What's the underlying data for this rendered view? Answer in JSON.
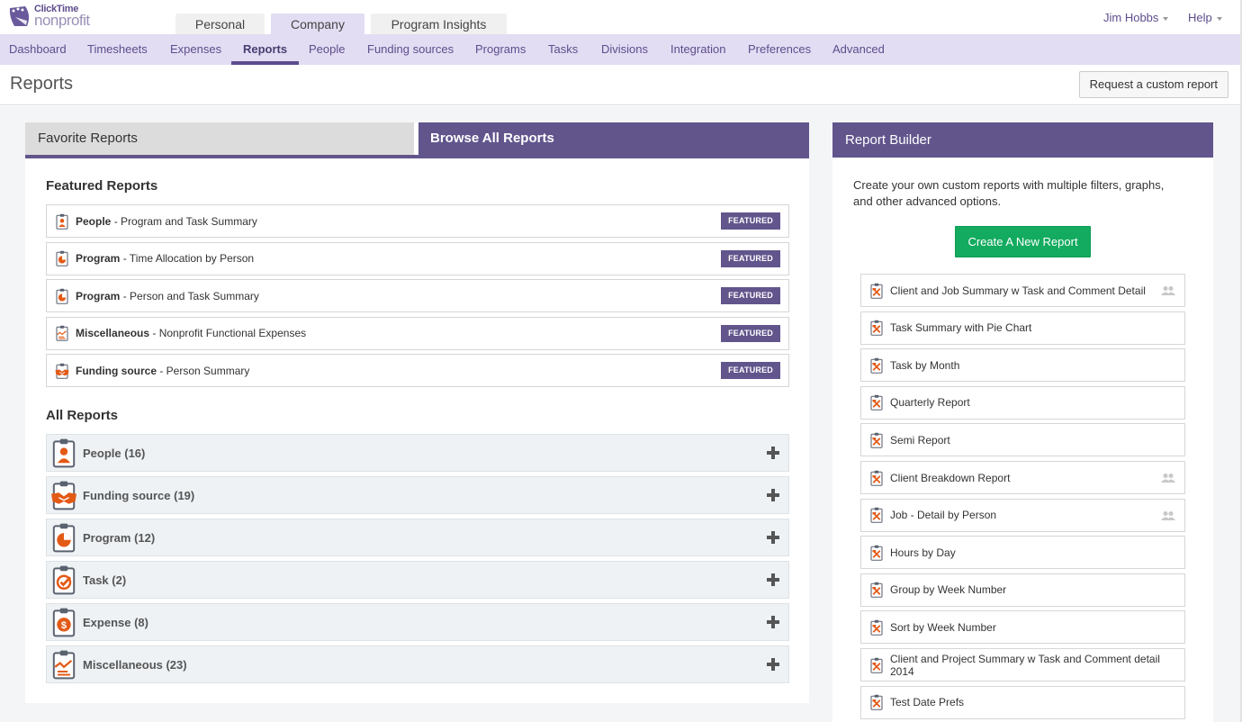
{
  "app": {
    "logo_line1": "ClickTime",
    "logo_line2": "nonprofit",
    "brand_color": "#62558c",
    "accent_color": "#e35a16"
  },
  "top_tabs": [
    {
      "label": "Personal",
      "active": false
    },
    {
      "label": "Company",
      "active": true
    },
    {
      "label": "Program Insights",
      "active": false
    }
  ],
  "user_menu": {
    "name": "Jim Hobbs",
    "help": "Help"
  },
  "nav": [
    {
      "label": "Dashboard"
    },
    {
      "label": "Timesheets"
    },
    {
      "label": "Expenses"
    },
    {
      "label": "Reports",
      "active": true
    },
    {
      "label": "People"
    },
    {
      "label": "Funding sources"
    },
    {
      "label": "Programs"
    },
    {
      "label": "Tasks"
    },
    {
      "label": "Divisions"
    },
    {
      "label": "Integration"
    },
    {
      "label": "Preferences"
    },
    {
      "label": "Advanced"
    }
  ],
  "page": {
    "title": "Reports",
    "request_button": "Request a custom report"
  },
  "report_tabs": {
    "favorites": "Favorite Reports",
    "browse": "Browse All Reports",
    "active": "browse"
  },
  "featured": {
    "title": "Featured Reports",
    "badge_label": "FEATURED",
    "items": [
      {
        "category": "People",
        "name": " - Program and Task Summary",
        "icon": "people-report-icon"
      },
      {
        "category": "Program",
        "name": " - Time Allocation by Person",
        "icon": "program-report-icon"
      },
      {
        "category": "Program",
        "name": " - Person and Task Summary",
        "icon": "program-report-icon"
      },
      {
        "category": "Miscellaneous",
        "name": " - Nonprofit Functional Expenses",
        "icon": "misc-report-icon"
      },
      {
        "category": "Funding source",
        "name": " - Person Summary",
        "icon": "funding-report-icon"
      }
    ]
  },
  "all_reports": {
    "title": "All Reports",
    "categories": [
      {
        "label": "People (16)",
        "icon": "people-report-icon"
      },
      {
        "label": "Funding source (19)",
        "icon": "funding-report-icon"
      },
      {
        "label": "Program (12)",
        "icon": "program-report-icon"
      },
      {
        "label": "Task (2)",
        "icon": "task-report-icon"
      },
      {
        "label": "Expense (8)",
        "icon": "expense-report-icon"
      },
      {
        "label": "Miscellaneous (23)",
        "icon": "misc-report-icon"
      }
    ]
  },
  "report_builder": {
    "title": "Report Builder",
    "description": "Create your own custom reports with multiple filters, graphs, and other advanced options.",
    "create_button": "Create A New Report",
    "reports": [
      {
        "name": "Client and Job Summary w Task and Comment Detail",
        "shared": true
      },
      {
        "name": "Task Summary with Pie Chart",
        "shared": false
      },
      {
        "name": "Task by Month",
        "shared": false
      },
      {
        "name": "Quarterly Report",
        "shared": false
      },
      {
        "name": "Semi Report",
        "shared": false
      },
      {
        "name": "Client Breakdown Report",
        "shared": true
      },
      {
        "name": "Job - Detail by Person",
        "shared": true
      },
      {
        "name": "Hours by Day",
        "shared": false
      },
      {
        "name": "Group by Week Number",
        "shared": false
      },
      {
        "name": "Sort by Week Number",
        "shared": false
      },
      {
        "name": "Client and Project Summary w Task and Comment detail 2014",
        "shared": false
      },
      {
        "name": "Test Date Prefs",
        "shared": false
      }
    ]
  }
}
